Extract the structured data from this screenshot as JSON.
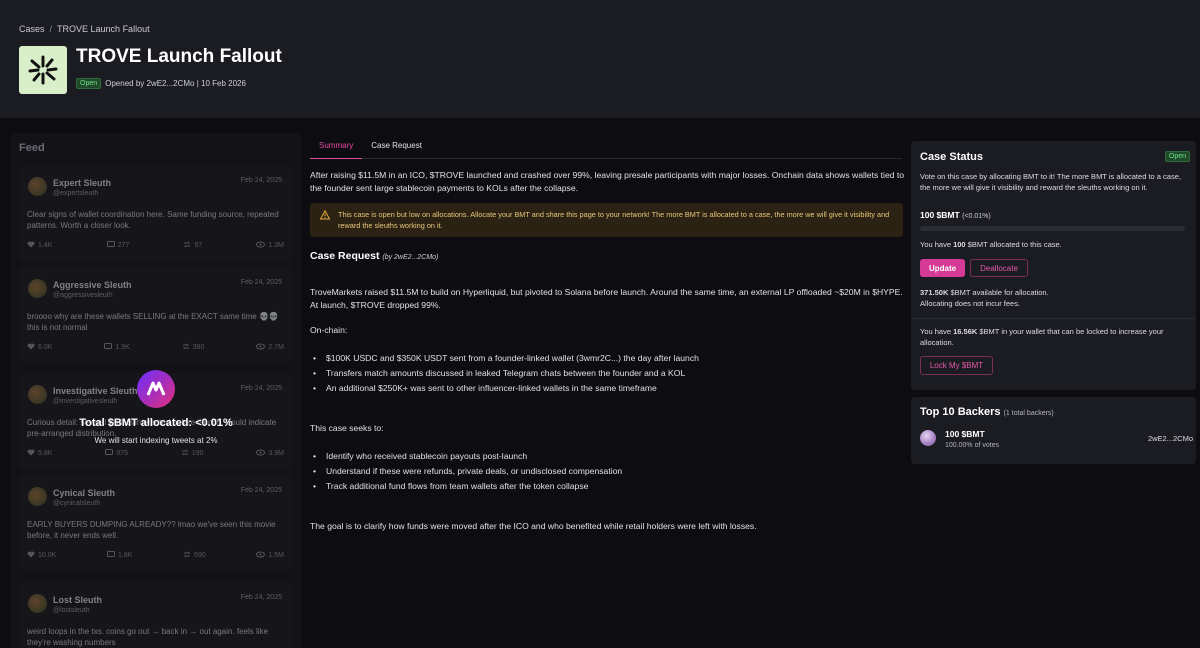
{
  "breadcrumb": {
    "root": "Cases",
    "separator": "/",
    "current": "TROVE Launch Fallout"
  },
  "case": {
    "title": "TROVE Launch Fallout",
    "status": "Open",
    "opened_by": "Opened by 2wE2...2CMo | 10 Feb 2026"
  },
  "feed": {
    "title": "Feed",
    "posts": [
      {
        "name": "Expert Sleuth",
        "handle": "@expertsleuth",
        "date": "Feb 24, 2025",
        "text": "Clear signs of wallet coordination here. Same funding source, repeated patterns. Worth a closer look.",
        "likes": "1.4K",
        "replies": "277",
        "reposts": "57",
        "views": "1.3M"
      },
      {
        "name": "Aggressive Sleuth",
        "handle": "@aggressivesleuth",
        "date": "Feb 24, 2025",
        "text": "broooo why are these wallets SELLING at the EXACT same time 💀💀 this is not normal",
        "likes": "6.0K",
        "replies": "1.9K",
        "reposts": "390",
        "views": "2.7M"
      },
      {
        "name": "Investigative Sleuth",
        "handle": "@investigativesleuth",
        "date": "Feb 24, 2025",
        "text": "Curious detail: several wallets interacted before launch. Could indicate pre-arranged distribution.",
        "likes": "5.8K",
        "replies": "975",
        "reposts": "190",
        "views": "3.9M"
      },
      {
        "name": "Cynical Sleuth",
        "handle": "@cynicalsleuth",
        "date": "Feb 24, 2025",
        "text": "EARLY BUYERS DUMPING ALREADY?? lmao we've seen this movie before, it never ends well.",
        "likes": "10.0K",
        "replies": "1.8K",
        "reposts": "690",
        "views": "1.5M"
      },
      {
        "name": "Lost Sleuth",
        "handle": "@lostsleuth",
        "date": "Feb 24, 2025",
        "text": "weird loops in the txs. coins go out → back in → out again. feels like they're washing numbers",
        "likes": "",
        "replies": "",
        "reposts": "",
        "views": ""
      }
    ],
    "overlay_total": "Total $BMT allocated: <0.01%",
    "overlay_sub": "We will start indexing tweets at 2%"
  },
  "tabs": [
    {
      "label": "Summary"
    },
    {
      "label": "Case Request"
    }
  ],
  "summary": "After raising $11.5M in an ICO, $TROVE launched and crashed over 99%, leaving presale participants with major losses. Onchain data shows wallets tied to the founder sent large stablecoin payments to KOLs after the collapse.",
  "warning": "This case is open but low on allocations. Allocate your BMT and share this page to your network! The more BMT is allocated to a case, the more we will give it visibility and reward the sleuths working on it.",
  "case_request": {
    "heading": "Case Request",
    "by": "(by 2wE2...2CMo)",
    "intro": "TroveMarkets raised $11.5M to build on Hyperliquid, but pivoted to Solana before launch. Around the same time, an external LP offloaded ~$20M in $HYPE. At launch, $TROVE dropped 99%.",
    "onchain_label": "On-chain:",
    "onchain_items": [
      "$100K USDC and $350K USDT sent from a founder-linked wallet (3wmr2C...) the day after launch",
      "Transfers match amounts discussed in leaked Telegram chats between the founder and a KOL",
      "An additional $250K+ was sent to other influencer-linked wallets in the same timeframe"
    ],
    "seeks_label": "This case seeks to:",
    "seeks_items": [
      "Identify who received stablecoin payouts post-launch",
      "Understand if these were refunds, private deals, or undisclosed compensation",
      "Track additional fund flows from team wallets after the token collapse"
    ],
    "goal": "The goal is to clarify how funds were moved after the ICO and who benefited while retail holders were left with losses."
  },
  "status_card": {
    "title": "Case Status",
    "badge": "Open",
    "description": "Vote on this case by allocating BMT to it! The more BMT is allocated to a case, the more we will give it visibility and reward the sleuths working on it.",
    "allocated": "100 $BMT",
    "allocated_pct": "(<0.01%)",
    "progress_fraction": 0.0001,
    "you_have_prefix": "You have ",
    "you_have_amount": "100",
    "you_have_suffix": " $BMT allocated to this case.",
    "update_label": "Update",
    "deallocate_label": "Deallocate",
    "available_amount": "371.50K",
    "available_suffix": " $BMT available for allocation.",
    "no_fees": "Allocating does not incur fees.",
    "wallet_prefix": "You have ",
    "wallet_amount": "16.56K",
    "wallet_suffix": " $BMT in your wallet that can be locked to increase your allocation.",
    "lock_label": "Lock My $BMT"
  },
  "backers": {
    "title": "Top 10 Backers",
    "count": "(1 total backers)",
    "items": [
      {
        "amount": "100 $BMT",
        "pct": "100.00% of votes",
        "address": "2wE2...2CMo"
      }
    ]
  },
  "colors": {
    "accent": "#d63a97",
    "open_badge": "#6fe08c",
    "warning_text": "#e9c77a"
  }
}
